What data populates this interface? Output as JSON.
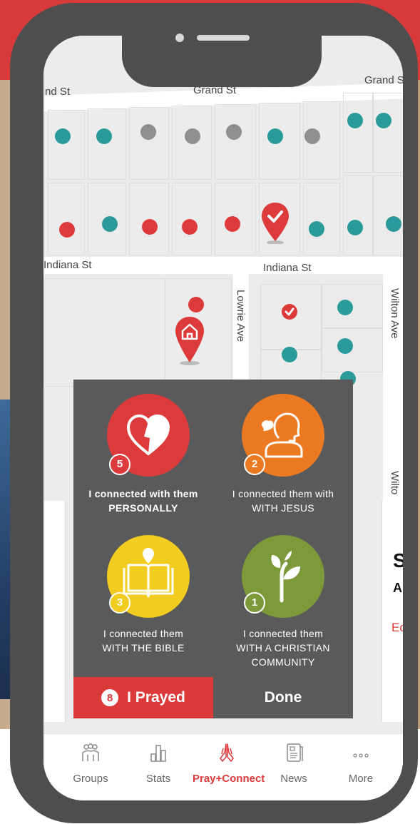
{
  "map": {
    "streets": {
      "grand_left": "nd St",
      "grand_center": "Grand St",
      "grand_right": "Grand S",
      "indiana_left": "Indiana St",
      "indiana_right": "Indiana St",
      "lowrie": "Lowrie Ave",
      "wilton": "Wilton Ave",
      "wilton_lower": "Wilto"
    }
  },
  "side_card": {
    "initial": "S",
    "sub_initial": "A",
    "link_fragment": "Ec"
  },
  "popup": {
    "items": [
      {
        "count": "5",
        "line1": "I connected with them",
        "line2": "PERSONALLY",
        "line3": "",
        "color": "#dd3b3b"
      },
      {
        "count": "2",
        "line1": "I connected them with",
        "line2": "WITH JESUS",
        "line3": "",
        "color": "#ec7a22"
      },
      {
        "count": "3",
        "line1": "I connected them",
        "line2": "WITH THE BIBLE",
        "line3": "",
        "color": "#f2cc1e"
      },
      {
        "count": "1",
        "line1": "I connected them",
        "line2": "WITH A CHRISTIAN",
        "line3": "COMMUNITY",
        "color": "#7c9a3a"
      }
    ],
    "prayed_count": "8",
    "prayed_label": "I Prayed",
    "done_label": "Done"
  },
  "nav": {
    "items": [
      {
        "label": "Groups",
        "icon": "groups-icon"
      },
      {
        "label": "Stats",
        "icon": "stats-icon"
      },
      {
        "label": "Pray+Connect",
        "icon": "praying-hands-icon",
        "active": true
      },
      {
        "label": "News",
        "icon": "news-icon"
      },
      {
        "label": "More",
        "icon": "more-icon"
      }
    ]
  },
  "colors": {
    "accent": "#dc3a3a",
    "teal": "#2a9a9a",
    "orange": "#ec7a22",
    "yellow": "#f2cc1e",
    "green": "#7c9a3a",
    "popup_bg": "#5a5a5a"
  }
}
